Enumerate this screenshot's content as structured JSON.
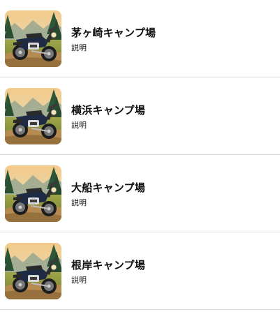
{
  "campsites": [
    {
      "name": "茅ヶ崎キャンプ場",
      "description": "説明",
      "thumbnail": "motorcycle-landscape-image"
    },
    {
      "name": "横浜キャンプ場",
      "description": "説明",
      "thumbnail": "motorcycle-landscape-image"
    },
    {
      "name": "大船キャンプ場",
      "description": "説明",
      "thumbnail": "motorcycle-landscape-image"
    },
    {
      "name": "根岸キャンプ場",
      "description": "説明",
      "thumbnail": "motorcycle-landscape-image"
    }
  ]
}
